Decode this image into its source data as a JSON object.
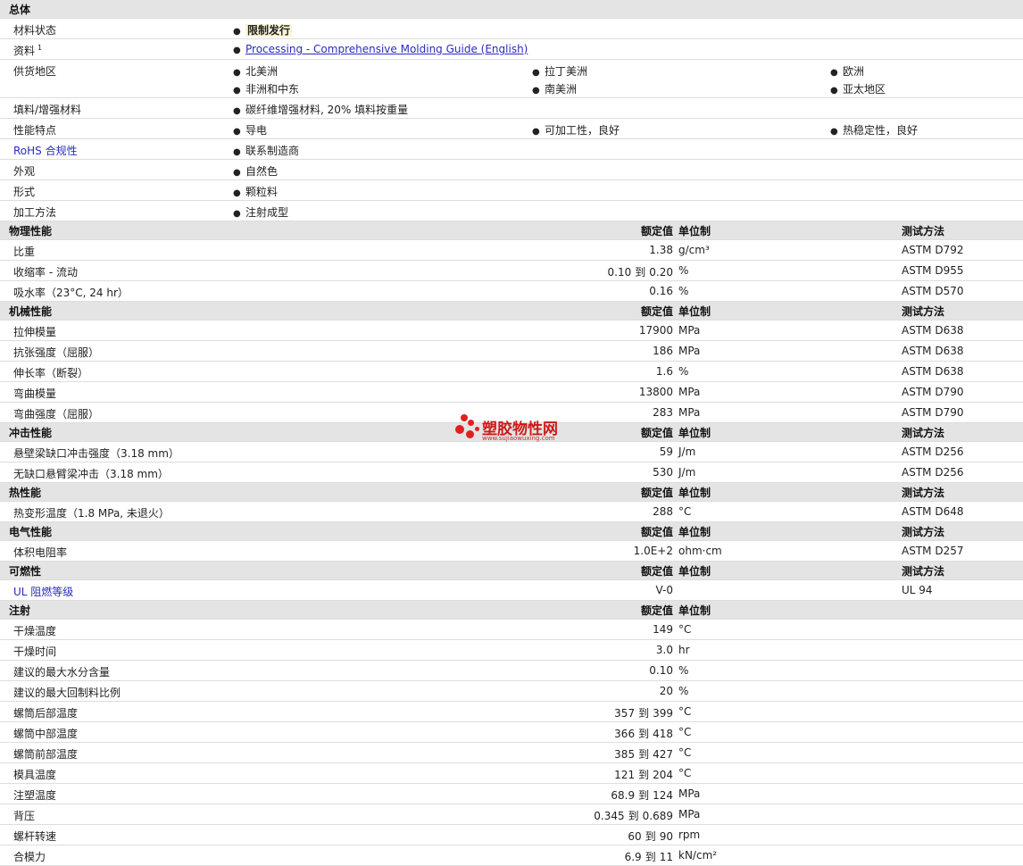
{
  "general": {
    "title": "总体",
    "rows": [
      {
        "label": "材料状态",
        "cols": [
          {
            "text": "限制发行",
            "style": "strong"
          }
        ]
      },
      {
        "label": "资料",
        "sup": "1",
        "cols": [
          {
            "text": "Processing - Comprehensive Molding Guide (English)",
            "style": "link"
          }
        ]
      },
      {
        "label": "供货地区",
        "cols": [
          {
            "text": "北美洲"
          },
          {
            "text": "拉丁美洲"
          },
          {
            "text": "欧洲"
          }
        ],
        "cols2": [
          {
            "text": "非洲和中东"
          },
          {
            "text": "南美洲"
          },
          {
            "text": "亚太地区"
          }
        ]
      },
      {
        "label": "填料/增强材料",
        "cols": [
          {
            "text": "碳纤维增强材料, 20% 填料按重量"
          }
        ]
      },
      {
        "label": "性能特点",
        "cols": [
          {
            "text": "导电"
          },
          {
            "text": "可加工性，良好"
          },
          {
            "text": "热稳定性，良好"
          }
        ]
      },
      {
        "label": "RoHS 合规性",
        "label_style": "rohs",
        "cols": [
          {
            "text": "联系制造商"
          }
        ]
      },
      {
        "label": "外观",
        "cols": [
          {
            "text": "自然色"
          }
        ]
      },
      {
        "label": "形式",
        "cols": [
          {
            "text": "颗粒料"
          }
        ]
      },
      {
        "label": "加工方法",
        "cols": [
          {
            "text": "注射成型"
          }
        ]
      }
    ]
  },
  "headers": {
    "value": "额定值",
    "unit": "单位制",
    "test": "测试方法"
  },
  "sections": [
    {
      "title": "物理性能",
      "show_test": true,
      "rows": [
        {
          "label": "比重",
          "v1": "1.38",
          "unit": "g/cm³",
          "test": "ASTM D792"
        },
        {
          "label": "收缩率 - 流动",
          "v1": "0.10",
          "sep": "到",
          "v2": "0.20",
          "unit": "%",
          "test": "ASTM D955"
        },
        {
          "label": "吸水率（23°C, 24 hr）",
          "v1": "0.16",
          "unit": "%",
          "test": "ASTM D570"
        }
      ]
    },
    {
      "title": "机械性能",
      "show_test": true,
      "rows": [
        {
          "label": "拉伸模量",
          "v1": "17900",
          "unit": "MPa",
          "test": "ASTM D638"
        },
        {
          "label": "抗张强度（屈服）",
          "v1": "186",
          "unit": "MPa",
          "test": "ASTM D638"
        },
        {
          "label": "伸长率（断裂）",
          "v1": "1.6",
          "unit": "%",
          "test": "ASTM D638"
        },
        {
          "label": "弯曲模量",
          "v1": "13800",
          "unit": "MPa",
          "test": "ASTM D790"
        },
        {
          "label": "弯曲强度（屈服）",
          "v1": "283",
          "unit": "MPa",
          "test": "ASTM D790"
        }
      ]
    },
    {
      "title": "冲击性能",
      "show_test": true,
      "rows": [
        {
          "label": "悬壁梁缺口冲击强度（3.18 mm）",
          "v1": "59",
          "unit": "J/m",
          "test": "ASTM D256"
        },
        {
          "label": "无缺口悬臂梁冲击（3.18 mm）",
          "v1": "530",
          "unit": "J/m",
          "test": "ASTM D256"
        }
      ]
    },
    {
      "title": "热性能",
      "show_test": true,
      "rows": [
        {
          "label": "热变形温度（1.8 MPa, 未退火）",
          "v1": "288",
          "unit": "°C",
          "test": "ASTM D648"
        }
      ]
    },
    {
      "title": "电气性能",
      "show_test": true,
      "rows": [
        {
          "label": "体积电阻率",
          "v1": "1.0E+2",
          "unit": "ohm·cm",
          "test": "ASTM D257"
        }
      ]
    },
    {
      "title": "可燃性",
      "show_test": true,
      "rows": [
        {
          "label": "UL 阻燃等级",
          "label_style": "rohs",
          "v1": "V-0",
          "unit": "",
          "test": "UL 94"
        }
      ]
    },
    {
      "title": "注射",
      "show_test": false,
      "rows": [
        {
          "label": "干燥温度",
          "v1": "149",
          "unit": "°C",
          "test": ""
        },
        {
          "label": "干燥时间",
          "v1": "3.0",
          "unit": "hr",
          "test": ""
        },
        {
          "label": "建议的最大水分含量",
          "v1": "0.10",
          "unit": "%",
          "test": ""
        },
        {
          "label": "建议的最大回制料比例",
          "v1": "20",
          "unit": "%",
          "test": ""
        },
        {
          "label": "螺筒后部温度",
          "v1": "357",
          "sep": "到",
          "v2": "399",
          "unit": "°C",
          "test": ""
        },
        {
          "label": "螺筒中部温度",
          "v1": "366",
          "sep": "到",
          "v2": "418",
          "unit": "°C",
          "test": ""
        },
        {
          "label": "螺筒前部温度",
          "v1": "385",
          "sep": "到",
          "v2": "427",
          "unit": "°C",
          "test": ""
        },
        {
          "label": "模具温度",
          "v1": "121",
          "sep": "到",
          "v2": "204",
          "unit": "°C",
          "test": ""
        },
        {
          "label": "注塑温度",
          "v1": "68.9",
          "sep": "到",
          "v2": "124",
          "unit": "MPa",
          "test": ""
        },
        {
          "label": "背压",
          "v1": "0.345",
          "sep": "到",
          "v2": "0.689",
          "unit": "MPa",
          "test": ""
        },
        {
          "label": "螺杆转速",
          "v1": "60",
          "sep": "到",
          "v2": "90",
          "unit": "rpm",
          "test": ""
        },
        {
          "label": "合模力",
          "v1": "6.9",
          "sep": "到",
          "v2": "11",
          "unit": "kN/cm²",
          "test": ""
        }
      ]
    }
  ],
  "watermark": {
    "title": "塑胶物性网",
    "url": "www.sujiaowuxing.com"
  },
  "colors": {
    "section_bg": "#e4e4e4",
    "link": "#2b2bbf",
    "border": "#dddddd",
    "watermark": "#e12020"
  }
}
